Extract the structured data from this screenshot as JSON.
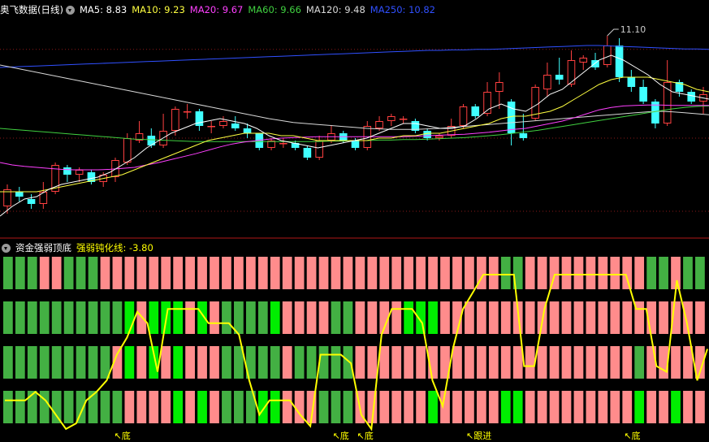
{
  "main_panel": {
    "title": "奥飞数据(日线)",
    "ma_labels": [
      {
        "text": "MA5: 8.83",
        "color": "#ffffff"
      },
      {
        "text": "MA10: 9.23",
        "color": "#ffff40"
      },
      {
        "text": "MA20: 9.67",
        "color": "#ff40ff"
      },
      {
        "text": "MA60: 9.66",
        "color": "#40d040"
      },
      {
        "text": "MA120: 9.48",
        "color": "#d8d8d8"
      },
      {
        "text": "MA250: 10.82",
        "color": "#3050ff"
      }
    ],
    "high_marker": "11.10"
  },
  "sub_panel": {
    "title": "资金强弱顶底",
    "line_label": "强弱钝化线: -3.80",
    "line_label_color": "#ffff00",
    "signals": [
      {
        "text": "↖底",
        "index": 9
      },
      {
        "text": "↖底",
        "index": 27
      },
      {
        "text": "↖底",
        "index": 29
      },
      {
        "text": "↖跟进",
        "index": 38
      },
      {
        "text": "↖底",
        "index": 51
      }
    ]
  },
  "colors": {
    "up": "#ff4040",
    "down": "#40ffff",
    "ma5": "#ffffff",
    "ma10": "#ffff40",
    "ma20": "#ff40ff",
    "ma60": "#40d040",
    "ma120": "#d8d8d8",
    "ma250": "#3050ff",
    "block_red": "#ff8c8c",
    "block_green": "#43b043",
    "block_bright": "#00ee00",
    "line": "#ffff00"
  },
  "chart_data": [
    {
      "type": "candlestick",
      "series_name": "奥飞数据(日线)",
      "ylim": [
        7.2,
        11.5
      ],
      "candles": [
        [
          7.6,
          7.95,
          7.45,
          8.05
        ],
        [
          7.9,
          7.8,
          7.7,
          8.0
        ],
        [
          7.75,
          7.65,
          7.55,
          7.85
        ],
        [
          7.65,
          7.9,
          7.55,
          8.1
        ],
        [
          7.9,
          8.45,
          7.85,
          8.5
        ],
        [
          8.4,
          8.25,
          8.1,
          8.45
        ],
        [
          8.25,
          8.35,
          8.1,
          8.4
        ],
        [
          8.3,
          8.1,
          8.05,
          8.35
        ],
        [
          8.1,
          8.25,
          8.0,
          8.3
        ],
        [
          8.2,
          8.55,
          8.1,
          8.6
        ],
        [
          8.5,
          9.0,
          8.45,
          9.1
        ],
        [
          8.95,
          9.1,
          8.9,
          9.35
        ],
        [
          9.05,
          8.85,
          8.8,
          9.2
        ],
        [
          8.85,
          9.15,
          8.8,
          9.5
        ],
        [
          9.15,
          9.6,
          9.05,
          9.65
        ],
        [
          9.55,
          9.55,
          9.4,
          9.7
        ],
        [
          9.55,
          9.25,
          9.15,
          9.6
        ],
        [
          9.25,
          9.25,
          9.1,
          9.35
        ],
        [
          9.25,
          9.35,
          9.2,
          9.45
        ],
        [
          9.3,
          9.2,
          9.15,
          9.45
        ],
        [
          9.2,
          9.1,
          9.0,
          9.3
        ],
        [
          9.1,
          8.8,
          8.75,
          9.1
        ],
        [
          8.8,
          8.95,
          8.75,
          9.0
        ],
        [
          8.9,
          8.9,
          8.8,
          9.0
        ],
        [
          8.9,
          8.8,
          8.75,
          8.95
        ],
        [
          8.8,
          8.6,
          8.55,
          8.85
        ],
        [
          8.6,
          8.95,
          8.55,
          9.05
        ],
        [
          8.95,
          9.1,
          8.9,
          9.25
        ],
        [
          9.1,
          8.95,
          8.9,
          9.15
        ],
        [
          8.95,
          8.8,
          8.75,
          9.0
        ],
        [
          8.8,
          9.25,
          8.75,
          9.35
        ],
        [
          9.2,
          9.35,
          9.15,
          9.45
        ],
        [
          9.35,
          9.45,
          9.25,
          9.5
        ],
        [
          9.4,
          9.4,
          9.3,
          9.45
        ],
        [
          9.35,
          9.15,
          9.1,
          9.4
        ],
        [
          9.15,
          9.0,
          8.95,
          9.2
        ],
        [
          9.0,
          9.05,
          8.95,
          9.1
        ],
        [
          9.05,
          9.25,
          9.0,
          9.4
        ],
        [
          9.25,
          9.65,
          9.2,
          9.7
        ],
        [
          9.65,
          9.45,
          9.4,
          9.7
        ],
        [
          9.5,
          9.95,
          9.45,
          10.15
        ],
        [
          9.95,
          10.15,
          9.6,
          10.35
        ],
        [
          9.75,
          9.1,
          8.85,
          9.8
        ],
        [
          9.1,
          9.0,
          8.95,
          9.5
        ],
        [
          9.4,
          10.05,
          9.35,
          10.1
        ],
        [
          10.0,
          10.3,
          9.85,
          10.55
        ],
        [
          10.3,
          10.2,
          10.1,
          10.65
        ],
        [
          10.1,
          10.6,
          10.05,
          10.8
        ],
        [
          10.55,
          10.65,
          10.4,
          10.7
        ],
        [
          10.6,
          10.45,
          10.4,
          10.75
        ],
        [
          10.5,
          10.9,
          10.45,
          11.1
        ],
        [
          10.9,
          10.25,
          10.15,
          11.05
        ],
        [
          10.25,
          10.05,
          9.95,
          10.4
        ],
        [
          10.05,
          9.75,
          9.7,
          10.2
        ],
        [
          9.75,
          9.3,
          9.2,
          9.8
        ],
        [
          9.3,
          10.15,
          9.25,
          10.6
        ],
        [
          10.15,
          9.95,
          9.85,
          10.2
        ],
        [
          9.95,
          9.75,
          9.7,
          10.0
        ],
        [
          9.75,
          9.9,
          9.5,
          10.05
        ]
      ],
      "ma_lines": {
        "ma5": [
          7.4,
          7.6,
          7.75,
          7.8,
          7.95,
          8.05,
          8.1,
          8.15,
          8.2,
          8.3,
          8.45,
          8.6,
          8.8,
          8.95,
          9.1,
          9.2,
          9.3,
          9.35,
          9.4,
          9.35,
          9.3,
          9.2,
          9.05,
          8.95,
          8.9,
          8.85,
          8.8,
          8.85,
          8.9,
          8.95,
          9.0,
          9.1,
          9.2,
          9.3,
          9.3,
          9.25,
          9.2,
          9.2,
          9.25,
          9.4,
          9.6,
          9.7,
          9.6,
          9.55,
          9.7,
          9.9,
          10.0,
          10.2,
          10.4,
          10.6,
          10.7,
          10.6,
          10.45,
          10.3,
          10.1,
          9.95,
          9.9,
          9.85,
          9.8
        ],
        "ma10": [
          7.9,
          7.9,
          7.9,
          7.9,
          7.95,
          8.0,
          8.05,
          8.1,
          8.15,
          8.2,
          8.25,
          8.35,
          8.45,
          8.55,
          8.65,
          8.75,
          8.85,
          8.95,
          9.0,
          9.05,
          9.1,
          9.1,
          9.1,
          9.05,
          9.05,
          9.0,
          8.95,
          8.95,
          8.95,
          8.95,
          8.95,
          9.0,
          9.0,
          9.05,
          9.05,
          9.1,
          9.1,
          9.15,
          9.2,
          9.25,
          9.3,
          9.4,
          9.45,
          9.45,
          9.5,
          9.55,
          9.65,
          9.8,
          9.95,
          10.1,
          10.2,
          10.25,
          10.25,
          10.25,
          10.2,
          10.15,
          10.1,
          10.0,
          9.95
        ],
        "ma20": [
          8.5,
          8.45,
          8.42,
          8.4,
          8.38,
          8.36,
          8.35,
          8.35,
          8.35,
          8.36,
          8.38,
          8.4,
          8.45,
          8.5,
          8.56,
          8.62,
          8.68,
          8.75,
          8.82,
          8.88,
          8.92,
          8.95,
          8.98,
          9.0,
          9.01,
          9.02,
          9.03,
          9.03,
          9.03,
          9.03,
          9.03,
          9.03,
          9.03,
          9.03,
          9.04,
          9.05,
          9.06,
          9.07,
          9.08,
          9.1,
          9.12,
          9.15,
          9.18,
          9.2,
          9.25,
          9.3,
          9.35,
          9.42,
          9.5,
          9.58,
          9.63,
          9.66,
          9.67,
          9.68,
          9.68,
          9.67,
          9.67,
          9.67,
          9.67
        ],
        "ma60": [
          9.2,
          9.18,
          9.16,
          9.14,
          9.12,
          9.1,
          9.08,
          9.06,
          9.04,
          9.02,
          9.0,
          8.98,
          8.97,
          8.96,
          8.95,
          8.94,
          8.93,
          8.93,
          8.93,
          8.93,
          8.93,
          8.93,
          8.93,
          8.93,
          8.93,
          8.93,
          8.93,
          8.94,
          8.94,
          8.95,
          8.95,
          8.96,
          8.96,
          8.97,
          8.97,
          8.98,
          8.99,
          9.0,
          9.01,
          9.03,
          9.05,
          9.07,
          9.1,
          9.13,
          9.16,
          9.2,
          9.24,
          9.28,
          9.32,
          9.36,
          9.4,
          9.44,
          9.48,
          9.52,
          9.56,
          9.6,
          9.63,
          9.65,
          9.66
        ],
        "ma120": [
          10.5,
          10.45,
          10.4,
          10.35,
          10.3,
          10.25,
          10.2,
          10.15,
          10.1,
          10.05,
          10.0,
          9.95,
          9.9,
          9.85,
          9.8,
          9.75,
          9.7,
          9.65,
          9.6,
          9.55,
          9.5,
          9.45,
          9.4,
          9.36,
          9.32,
          9.3,
          9.28,
          9.26,
          9.24,
          9.22,
          9.2,
          9.19,
          9.18,
          9.18,
          9.18,
          9.19,
          9.2,
          9.22,
          9.24,
          9.26,
          9.28,
          9.3,
          9.32,
          9.34,
          9.36,
          9.38,
          9.4,
          9.42,
          9.44,
          9.46,
          9.48,
          9.5,
          9.52,
          9.54,
          9.55,
          9.54,
          9.52,
          9.5,
          9.48
        ],
        "ma250": [
          10.45,
          10.46,
          10.47,
          10.48,
          10.49,
          10.5,
          10.51,
          10.52,
          10.53,
          10.54,
          10.55,
          10.56,
          10.57,
          10.58,
          10.59,
          10.6,
          10.61,
          10.62,
          10.63,
          10.64,
          10.65,
          10.66,
          10.67,
          10.68,
          10.69,
          10.7,
          10.71,
          10.72,
          10.73,
          10.74,
          10.75,
          10.76,
          10.77,
          10.78,
          10.79,
          10.8,
          10.8,
          10.81,
          10.81,
          10.82,
          10.82,
          10.83,
          10.84,
          10.85,
          10.86,
          10.87,
          10.88,
          10.89,
          10.9,
          10.9,
          10.89,
          10.88,
          10.87,
          10.86,
          10.85,
          10.84,
          10.83,
          10.83,
          10.82
        ]
      },
      "ma_values": {
        "MA5": 8.83,
        "MA10": 9.23,
        "MA20": 9.67,
        "MA60": 9.66,
        "MA120": 9.48,
        "MA250": 10.82
      },
      "annotations": [
        {
          "index": 50,
          "text": "11.10"
        }
      ]
    },
    {
      "type": "indicator",
      "series_name": "资金强弱顶底",
      "line_name": "强弱钝化线",
      "line_value": -3.8,
      "rows": 4,
      "columns": [
        [
          "G",
          "G",
          "G",
          "G"
        ],
        [
          "G",
          "G",
          "G",
          "G"
        ],
        [
          "G",
          "G",
          "G",
          "G"
        ],
        [
          "R",
          "G",
          "G",
          "G"
        ],
        [
          "R",
          "G",
          "G",
          "G"
        ],
        [
          "G",
          "G",
          "G",
          "G"
        ],
        [
          "G",
          "G",
          "G",
          "G"
        ],
        [
          "G",
          "G",
          "G",
          "G"
        ],
        [
          "R",
          "G",
          "G",
          "G"
        ],
        [
          "R",
          "G",
          "R",
          "G"
        ],
        [
          "R",
          "B",
          "B",
          "R"
        ],
        [
          "R",
          "R",
          "R",
          "R"
        ],
        [
          "R",
          "B",
          "B",
          "R"
        ],
        [
          "R",
          "B",
          "R",
          "R"
        ],
        [
          "R",
          "B",
          "B",
          "B"
        ],
        [
          "R",
          "R",
          "R",
          "R"
        ],
        [
          "R",
          "B",
          "R",
          "B"
        ],
        [
          "R",
          "R",
          "R",
          "R"
        ],
        [
          "R",
          "G",
          "G",
          "G"
        ],
        [
          "R",
          "G",
          "G",
          "G"
        ],
        [
          "R",
          "G",
          "G",
          "G"
        ],
        [
          "R",
          "G",
          "G",
          "B"
        ],
        [
          "R",
          "B",
          "G",
          "B"
        ],
        [
          "R",
          "R",
          "R",
          "R"
        ],
        [
          "R",
          "R",
          "G",
          "R"
        ],
        [
          "R",
          "R",
          "G",
          "R"
        ],
        [
          "R",
          "R",
          "G",
          "G"
        ],
        [
          "R",
          "G",
          "G",
          "G"
        ],
        [
          "R",
          "G",
          "G",
          "G"
        ],
        [
          "R",
          "R",
          "R",
          "R"
        ],
        [
          "R",
          "R",
          "R",
          "R"
        ],
        [
          "R",
          "R",
          "R",
          "R"
        ],
        [
          "R",
          "R",
          "R",
          "R"
        ],
        [
          "R",
          "B",
          "R",
          "R"
        ],
        [
          "R",
          "B",
          "R",
          "R"
        ],
        [
          "R",
          "B",
          "R",
          "B"
        ],
        [
          "R",
          "R",
          "R",
          "R"
        ],
        [
          "R",
          "R",
          "R",
          "R"
        ],
        [
          "R",
          "R",
          "R",
          "R"
        ],
        [
          "R",
          "R",
          "R",
          "R"
        ],
        [
          "R",
          "R",
          "R",
          "R"
        ],
        [
          "G",
          "R",
          "R",
          "B"
        ],
        [
          "G",
          "R",
          "R",
          "B"
        ],
        [
          "R",
          "R",
          "R",
          "R"
        ],
        [
          "R",
          "R",
          "R",
          "R"
        ],
        [
          "R",
          "R",
          "R",
          "R"
        ],
        [
          "R",
          "R",
          "R",
          "R"
        ],
        [
          "R",
          "R",
          "R",
          "R"
        ],
        [
          "R",
          "R",
          "R",
          "R"
        ],
        [
          "R",
          "R",
          "R",
          "R"
        ],
        [
          "R",
          "R",
          "R",
          "R"
        ],
        [
          "R",
          "R",
          "R",
          "R"
        ],
        [
          "R",
          "R",
          "G",
          "B"
        ],
        [
          "G",
          "R",
          "R",
          "R"
        ],
        [
          "G",
          "R",
          "R",
          "R"
        ],
        [
          "R",
          "R",
          "R",
          "B"
        ],
        [
          "G",
          "R",
          "R",
          "R"
        ],
        [
          "G",
          "R",
          "R",
          "R"
        ]
      ],
      "line_levels": [
        0.5,
        0.5,
        0.5,
        0.65,
        0.5,
        0.25,
        0.0,
        0.1,
        0.5,
        0.65,
        0.85,
        1.3,
        1.6,
        2.05,
        1.85,
        1.0,
        2.1,
        2.1,
        2.1,
        2.1,
        1.85,
        1.85,
        1.85,
        1.65,
        0.85,
        0.25,
        0.5,
        0.5,
        0.5,
        0.25,
        0.05,
        1.3,
        1.3,
        1.3,
        1.15,
        0.25,
        0.0,
        1.65,
        2.1,
        2.1,
        2.1,
        1.85,
        0.85,
        0.4,
        1.4,
        2.1,
        2.4,
        2.7,
        2.7,
        2.7,
        2.7,
        1.1,
        1.1,
        2.1,
        2.7,
        2.7,
        2.7,
        2.7,
        2.7,
        2.7,
        2.7,
        2.7,
        2.1,
        2.1,
        1.1,
        1.0,
        2.6,
        1.85,
        0.85,
        1.4
      ]
    }
  ]
}
